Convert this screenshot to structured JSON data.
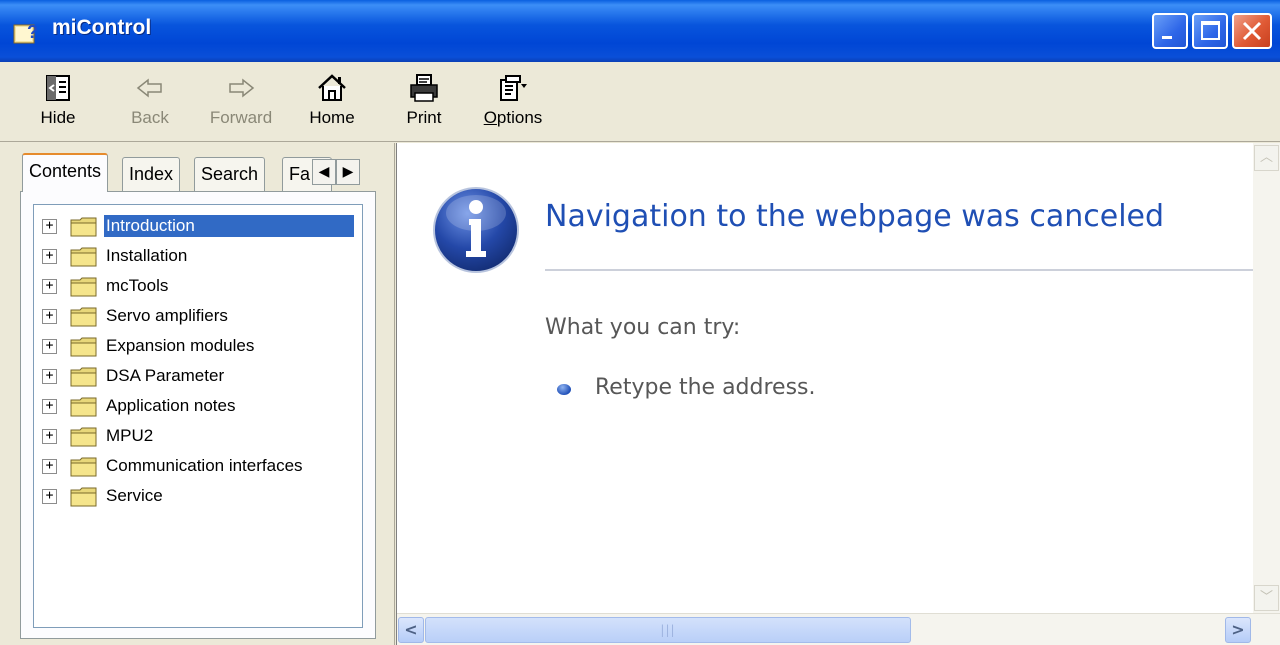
{
  "window": {
    "title": "miControl",
    "title_icon": "help-book-icon",
    "controls": [
      "minimize",
      "maximize",
      "close"
    ]
  },
  "toolbar": {
    "buttons": [
      {
        "label": "Hide",
        "icon": "hide-pane-icon",
        "enabled": true
      },
      {
        "label": "Back",
        "icon": "back-arrow-icon",
        "enabled": false
      },
      {
        "label": "Forward",
        "icon": "forward-arrow-icon",
        "enabled": false
      },
      {
        "label": "Home",
        "icon": "home-icon",
        "enabled": true
      },
      {
        "label": "Print",
        "icon": "printer-icon",
        "enabled": true
      },
      {
        "label": "Options",
        "icon": "options-icon",
        "enabled": true
      }
    ]
  },
  "tabs": [
    {
      "label": "Contents",
      "active": true
    },
    {
      "label": "Index",
      "active": false
    },
    {
      "label": "Search",
      "active": false
    },
    {
      "label": "Fa",
      "active": false
    }
  ],
  "tree": [
    {
      "label": "Introduction",
      "selected": true
    },
    {
      "label": "Installation",
      "selected": false
    },
    {
      "label": "mcTools",
      "selected": false
    },
    {
      "label": "Servo amplifiers",
      "selected": false
    },
    {
      "label": "Expansion modules",
      "selected": false
    },
    {
      "label": "DSA Parameter",
      "selected": false
    },
    {
      "label": "Application notes",
      "selected": false
    },
    {
      "label": "MPU2",
      "selected": false
    },
    {
      "label": "Communication interfaces",
      "selected": false
    },
    {
      "label": "Service",
      "selected": false
    }
  ],
  "content": {
    "heading": "Navigation to the webpage was canceled",
    "try_label": "What you can try:",
    "suggestions": [
      "Retype the address."
    ]
  },
  "colors": {
    "title_bar": "#0855DD",
    "selection": "#316AC5",
    "heading": "#1F4FB4"
  }
}
